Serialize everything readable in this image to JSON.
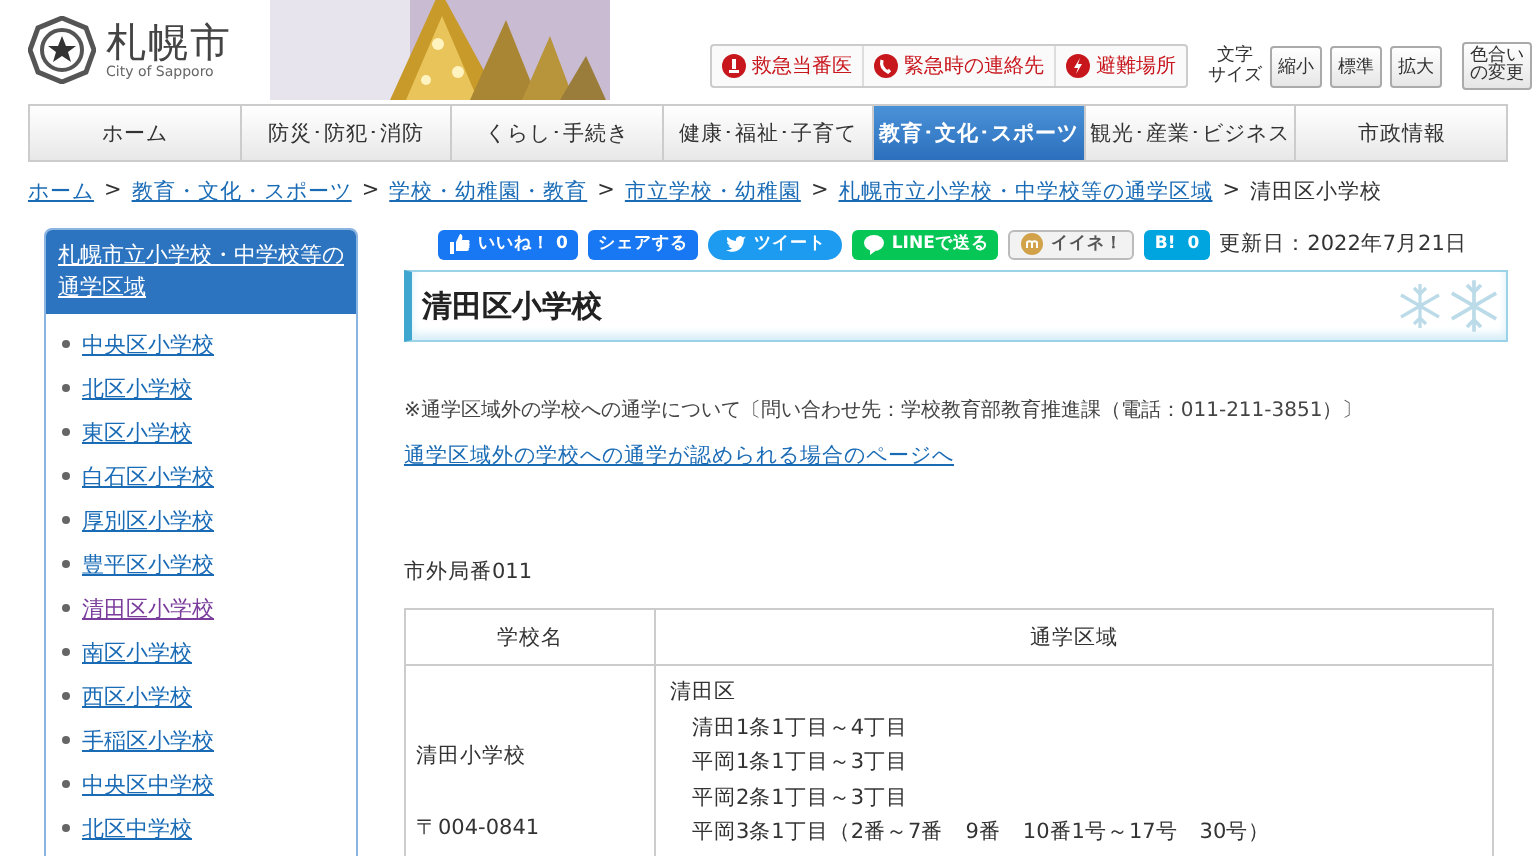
{
  "header": {
    "logo": {
      "name": "札幌市",
      "subtitle": "City of Sapporo"
    },
    "emergency_links": [
      {
        "kind": "medical",
        "label": "救急当番医"
      },
      {
        "kind": "phone",
        "label": "緊急時の連絡先"
      },
      {
        "kind": "shelter",
        "label": "避難場所"
      }
    ],
    "text_size": {
      "label_lines": [
        "文字",
        "サイズ"
      ],
      "buttons": [
        "縮小",
        "標準",
        "拡大"
      ]
    },
    "color_button": {
      "lines": [
        "色合い",
        "の変更"
      ]
    }
  },
  "nav": [
    {
      "label": "ホーム",
      "selected": false
    },
    {
      "label": "防災･防犯･消防",
      "selected": false
    },
    {
      "label": "くらし･手続き",
      "selected": false
    },
    {
      "label": "健康･福祉･子育て",
      "selected": false
    },
    {
      "label": "教育･文化･スポーツ",
      "selected": true
    },
    {
      "label": "観光･産業･ビジネス",
      "selected": false
    },
    {
      "label": "市政情報",
      "selected": false
    }
  ],
  "breadcrumb": {
    "links": [
      "ホーム",
      "教育・文化・スポーツ",
      "学校・幼稚園・教育",
      "市立学校・幼稚園",
      "札幌市立小学校・中学校等の通学区域"
    ],
    "separator": ">",
    "current": "清田区小学校"
  },
  "sidebar": {
    "title": "札幌市立小学校・中学校等の通学区域",
    "items": [
      {
        "label": "中央区小学校",
        "selected": false
      },
      {
        "label": "北区小学校",
        "selected": false
      },
      {
        "label": "東区小学校",
        "selected": false
      },
      {
        "label": "白石区小学校",
        "selected": false
      },
      {
        "label": "厚別区小学校",
        "selected": false
      },
      {
        "label": "豊平区小学校",
        "selected": false
      },
      {
        "label": "清田区小学校",
        "selected": true
      },
      {
        "label": "南区小学校",
        "selected": false
      },
      {
        "label": "西区小学校",
        "selected": false
      },
      {
        "label": "手稲区小学校",
        "selected": false
      },
      {
        "label": "中央区中学校",
        "selected": false
      },
      {
        "label": "北区中学校",
        "selected": false
      }
    ]
  },
  "share_buttons": [
    {
      "kind": "facebook",
      "label": "いいね！ 0"
    },
    {
      "kind": "share",
      "label": "シェアする"
    },
    {
      "kind": "twitter",
      "label": "ツイート"
    },
    {
      "kind": "line",
      "label": "LINEで送る"
    },
    {
      "kind": "mixi",
      "label": "イイネ！"
    },
    {
      "kind": "hatena",
      "label": "B!",
      "count": "0"
    }
  ],
  "updated": "更新日：2022年7月21日",
  "page_title": "清田区小学校",
  "note": "※通学区域外の学校への通学について〔問い合わせ先：学校教育部教育推進課（電話：011-211-3851）〕",
  "note_link": "通学区域外の学校への通学が認められる場合のページへ",
  "area_code": "市外局番011",
  "table": {
    "columns": [
      "学校名",
      "通学区域"
    ],
    "rows": [
      {
        "school": "清田小学校",
        "postal": "〒004-0841",
        "district": "清田区",
        "areas": [
          "清田1条1丁目～4丁目",
          "平岡1条1丁目～3丁目",
          "平岡2条1丁目～3丁目",
          "平岡3条1丁目（2番～7番　9番　10番1号～17号　30号）"
        ]
      }
    ]
  }
}
